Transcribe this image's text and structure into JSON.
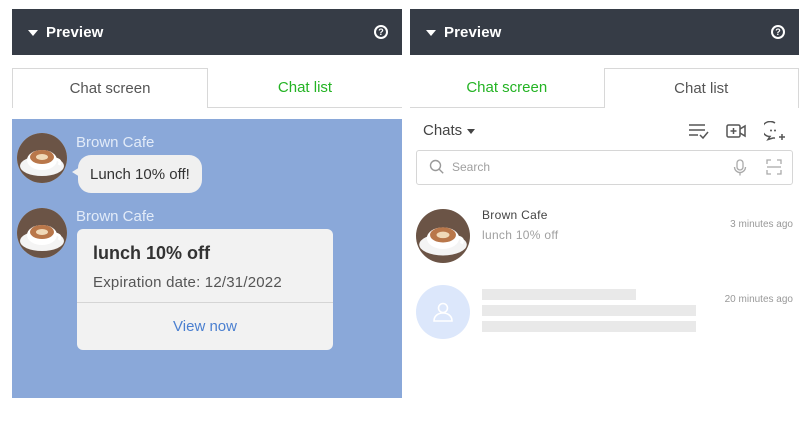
{
  "preview_title": "Preview",
  "tabs": {
    "chat_screen": "Chat screen",
    "chat_list": "Chat list"
  },
  "chat_screen": {
    "messages": [
      {
        "sender": "Brown Cafe",
        "text": "Lunch 10% off!"
      },
      {
        "sender": "Brown Cafe",
        "card": {
          "title": "lunch 10% off",
          "expiration": "Expiration date: 12/31/2022",
          "button": "View now"
        }
      }
    ]
  },
  "chat_list": {
    "dropdown_label": "Chats",
    "search_placeholder": "Search",
    "items": [
      {
        "name": "Brown Cafe",
        "message": "lunch 10% off",
        "time": "3 minutes ago"
      },
      {
        "placeholder": true,
        "time": "20 minutes ago"
      }
    ]
  },
  "colors": {
    "header_bg": "#363c46",
    "chat_bg": "#8aa8d9",
    "inactive_tab": "#24b324",
    "link": "#4a7fd0"
  },
  "icons": [
    "help-icon",
    "sort-check-icon",
    "video-plus-icon",
    "chat-plus-icon",
    "search-icon",
    "microphone-icon",
    "scan-icon",
    "person-icon"
  ]
}
